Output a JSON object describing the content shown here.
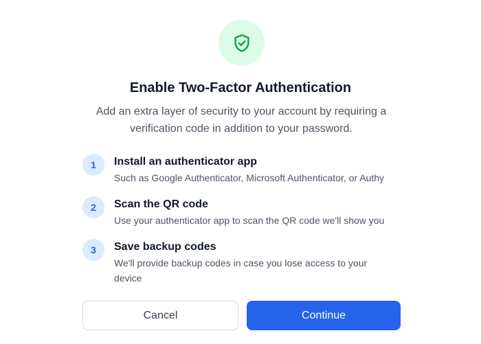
{
  "header": {
    "icon": "shield-check-icon",
    "title": "Enable Two-Factor Authentication",
    "description": "Add an extra layer of security to your account by requiring a verification code in addition to your password."
  },
  "steps": [
    {
      "number": "1",
      "title": "Install an authenticator app",
      "text": "Such as Google Authenticator, Microsoft Authenticator, or Authy"
    },
    {
      "number": "2",
      "title": "Scan the QR code",
      "text": "Use your authenticator app to scan the QR code we'll show you"
    },
    {
      "number": "3",
      "title": "Save backup codes",
      "text": "We'll provide backup codes in case you lose access to your device"
    }
  ],
  "actions": {
    "cancel_label": "Cancel",
    "continue_label": "Continue"
  },
  "colors": {
    "accent": "#2563eb",
    "icon_bg": "#dcfce7",
    "icon_stroke": "#16a34a",
    "step_bg": "#dbeafe"
  }
}
